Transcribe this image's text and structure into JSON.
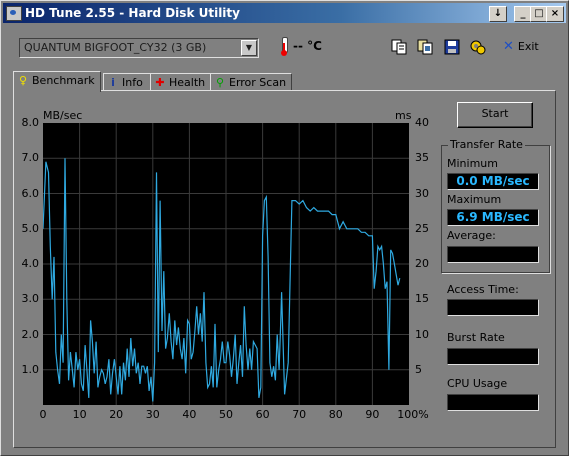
{
  "window": {
    "title": "HD Tune 2.55 - Hard Disk Utility"
  },
  "toolbar": {
    "drive": "QUANTUM BIGFOOT_CY32 (3 GB)",
    "temperature": "-- °C",
    "exit_label": "Exit"
  },
  "tabs": [
    {
      "label": "Benchmark",
      "icon": "lightbulb-icon",
      "active": true
    },
    {
      "label": "Info",
      "icon": "info-icon",
      "active": false
    },
    {
      "label": "Health",
      "icon": "health-cross-icon",
      "active": false
    },
    {
      "label": "Error Scan",
      "icon": "magnifier-icon",
      "active": false
    }
  ],
  "benchmark": {
    "start_label": "Start",
    "transfer_rate": {
      "title": "Transfer Rate",
      "minimum_label": "Minimum",
      "minimum_value": "0.0 MB/sec",
      "maximum_label": "Maximum",
      "maximum_value": "6.9 MB/sec",
      "average_label": "Average:",
      "average_value": ""
    },
    "access_time_label": "Access Time:",
    "access_time_value": "",
    "burst_rate_label": "Burst Rate",
    "burst_rate_value": "",
    "cpu_usage_label": "CPU Usage",
    "cpu_usage_value": ""
  },
  "colors": {
    "line": "#2fa9e0",
    "plot_bg": "#000000",
    "grid": "#3a3a3a",
    "value_text": "#2ab8ff"
  },
  "chart_data": {
    "type": "line",
    "ylabel_left": "MB/sec",
    "ylabel_right": "ms",
    "ylim": [
      0,
      8
    ],
    "ylim_right": [
      0,
      40
    ],
    "xlim": [
      0,
      100
    ],
    "y_ticks": [
      "8.0",
      "7.0",
      "6.0",
      "5.0",
      "4.0",
      "3.0",
      "2.0",
      "1.0"
    ],
    "y_right_ticks": [
      "40",
      "35",
      "30",
      "25",
      "20",
      "15",
      "10",
      "5"
    ],
    "x_ticks": [
      "0",
      "10",
      "20",
      "30",
      "40",
      "50",
      "60",
      "70",
      "80",
      "90",
      "100%"
    ],
    "grid": true,
    "series": [
      {
        "x": [
          0,
          0.8,
          1.5,
          2,
          2.5,
          3,
          3.5,
          4,
          4.5,
          5,
          5.5,
          6,
          6.5,
          7,
          7.5,
          8,
          8.5,
          9,
          9.5,
          10,
          10.5,
          11,
          11.5,
          12,
          12.5,
          13,
          13.5,
          14,
          14.5,
          15,
          15.5,
          16,
          16.5,
          17,
          17.5,
          18,
          18.5,
          19,
          19.5,
          20,
          20.5,
          21,
          21.5,
          22,
          22.5,
          23,
          23.5,
          24,
          24.5,
          25,
          25.5,
          26,
          26.5,
          27,
          27.5,
          28,
          28.5,
          29,
          29.5,
          30,
          30.5,
          31,
          31.5,
          32,
          32.5,
          33,
          33.5,
          34,
          34.5,
          35,
          35.5,
          36,
          36.5,
          37,
          37.5,
          38,
          38.5,
          39,
          39.5,
          40,
          40.5,
          41,
          41.5,
          42,
          42.5,
          43,
          43.5,
          44,
          44.5,
          45,
          45.5,
          46,
          46.5,
          47,
          47.5,
          48,
          48.5,
          49,
          49.5,
          50,
          50.5,
          51,
          51.5,
          52,
          52.5,
          53,
          53.5,
          54,
          54.5,
          55,
          55.5,
          56,
          56.5,
          57,
          57.5,
          58,
          58.5,
          59,
          59.5,
          60,
          60.5,
          61,
          61.5,
          62,
          62.5,
          63,
          63.5,
          64,
          64.5,
          65,
          65.2,
          66,
          67,
          68,
          69,
          70,
          71,
          72,
          73,
          74,
          75,
          76,
          77,
          78,
          79,
          80,
          81,
          82,
          83,
          84,
          85,
          86,
          87,
          88,
          89,
          90,
          90.5,
          91,
          91.5,
          92,
          92.5,
          93,
          93.5,
          94,
          94.5,
          95,
          95.5,
          96,
          96.5,
          97,
          97.5
        ],
        "y": [
          5.0,
          6.9,
          6.6,
          4.5,
          3.0,
          4.2,
          1.5,
          1.0,
          0.6,
          2.0,
          1.2,
          7.0,
          3.0,
          0.7,
          1.5,
          1.0,
          0.5,
          1.5,
          1.0,
          1.3,
          0.6,
          0.4,
          1.7,
          1.0,
          0.2,
          2.4,
          1.8,
          0.9,
          1.8,
          0.5,
          0.8,
          1.0,
          0.9,
          0.6,
          0.8,
          1.3,
          0.3,
          0.9,
          1.3,
          0.8,
          0.3,
          1.1,
          0.3,
          1.2,
          0.7,
          1.6,
          0.8,
          1.9,
          1.1,
          1.6,
          0.9,
          1.2,
          0.6,
          1.1,
          1.1,
          0.9,
          1.1,
          0.4,
          0.8,
          0.1,
          1.2,
          6.6,
          1.5,
          5.8,
          2.1,
          3.8,
          1.6,
          1.9,
          2.6,
          1.8,
          1.3,
          2.4,
          1.7,
          2.2,
          1.6,
          1.3,
          1.9,
          0.9,
          2.4,
          2.3,
          1.3,
          1.5,
          2.1,
          2.8,
          2.0,
          2.6,
          1.8,
          3.2,
          1.2,
          0.5,
          0.6,
          1.1,
          0.5,
          2.3,
          0.5,
          1.0,
          1.3,
          1.8,
          1.2,
          1.2,
          1.8,
          1.4,
          0.8,
          1.3,
          2.0,
          0.6,
          1.2,
          1.7,
          0.8,
          2.8,
          1.7,
          1.0,
          1.6,
          1.0,
          1.8,
          1.7,
          1.6,
          0.2,
          0.5,
          4.8,
          5.8,
          5.9,
          4.2,
          1.2,
          0.8,
          1.1,
          0.7,
          2.0,
          1.0,
          2.5,
          3.2,
          0.3,
          1.2,
          5.8,
          5.8,
          5.7,
          5.8,
          5.6,
          5.5,
          5.6,
          5.5,
          5.5,
          5.5,
          5.5,
          5.4,
          5.4,
          5.0,
          5.2,
          5.0,
          5.0,
          5.0,
          5.0,
          4.9,
          4.9,
          4.8,
          4.8,
          3.3,
          3.8,
          4.5,
          4.4,
          4.5,
          4.0,
          3.3,
          3.5,
          1.0,
          4.4,
          4.3,
          4.0,
          3.7,
          3.4,
          3.6
        ]
      }
    ]
  }
}
